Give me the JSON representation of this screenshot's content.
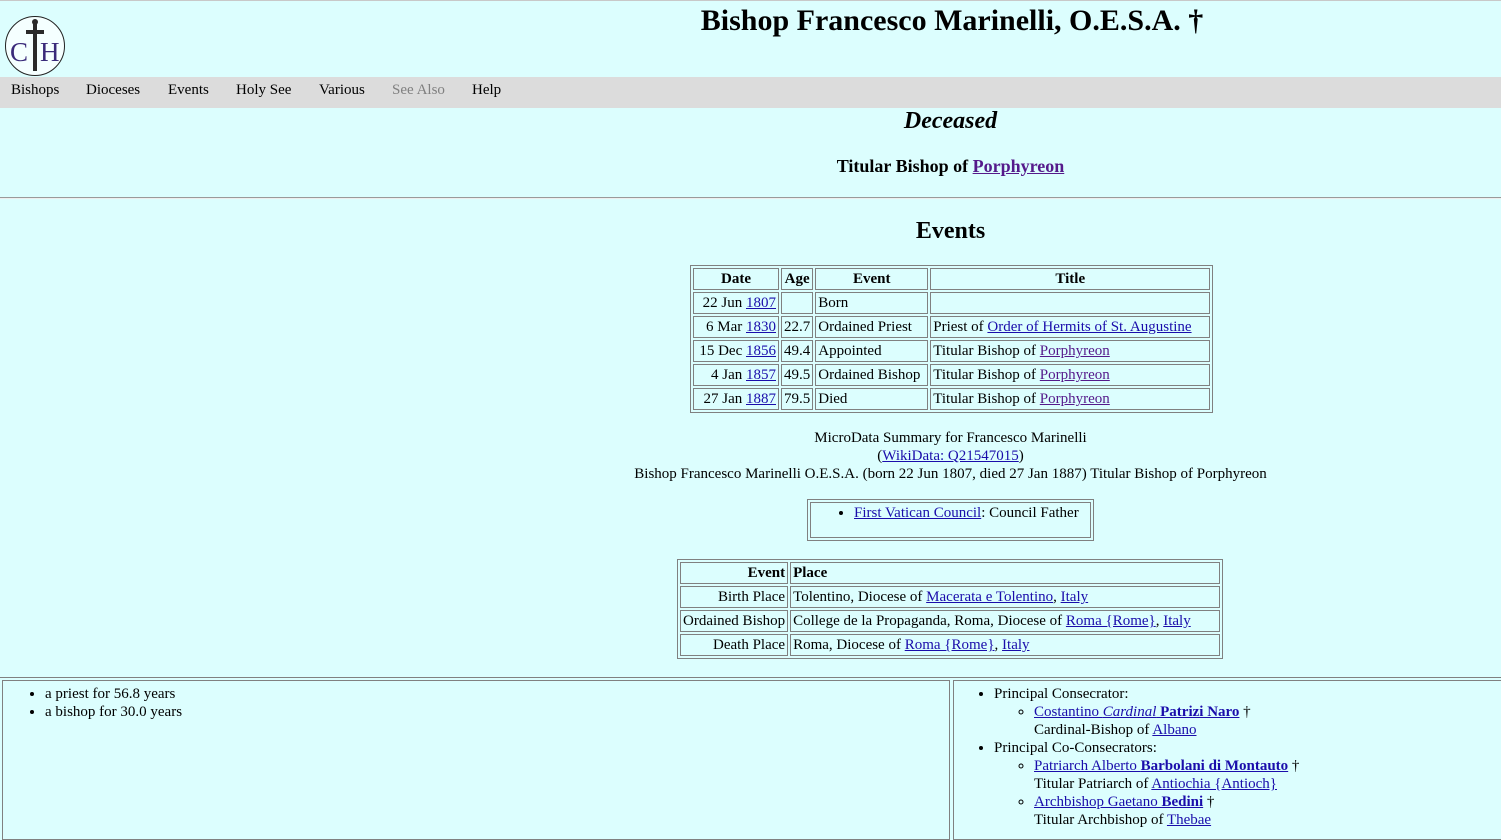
{
  "header": {
    "title": "Bishop Francesco Marinelli, O.E.S.A. †",
    "logo_icon": "catholic-hierarchy-cross-logo",
    "logo_letters": "CH"
  },
  "menu": [
    "Bishops",
    "Dioceses",
    "Events",
    "Holy See",
    "Various",
    "See Also",
    "Help"
  ],
  "status": "Deceased",
  "titular": {
    "prefix": "Titular Bishop of ",
    "link": "Porphyreon"
  },
  "events_heading": "Events",
  "events_table": {
    "headers": [
      "Date",
      "Age",
      "Event",
      "Title"
    ],
    "rows": [
      {
        "date": "22 Jun ",
        "year": "1807",
        "age": "",
        "event": "Born",
        "title_prefix": "",
        "title_link": ""
      },
      {
        "date": "6 Mar ",
        "year": "1830",
        "age": "22.7",
        "event": "Ordained Priest",
        "title_prefix": "Priest of ",
        "title_link": "Order of Hermits of St. Augustine"
      },
      {
        "date": "15 Dec ",
        "year": "1856",
        "age": "49.4",
        "event": "Appointed",
        "title_prefix": "Titular Bishop of ",
        "title_link": "Porphyreon"
      },
      {
        "date": "4 Jan ",
        "year": "1857",
        "age": "49.5",
        "event": "Ordained Bishop",
        "title_prefix": "Titular Bishop of ",
        "title_link": "Porphyreon"
      },
      {
        "date": "27 Jan ",
        "year": "1887",
        "age": "79.5",
        "event": "Died",
        "title_prefix": "Titular Bishop of ",
        "title_link": "Porphyreon"
      }
    ]
  },
  "microdata": {
    "line1": "MicroData Summary for Francesco Marinelli",
    "wikidata_open": "(",
    "wikidata_link": "WikiData: Q21547015",
    "wikidata_close": ")",
    "line3": "Bishop Francesco Marinelli O.E.S.A. (born 22 Jun 1807, died 27 Jan 1887) Titular Bishop of Porphyreon"
  },
  "council": {
    "link": "First Vatican Council",
    "role": ": Council Father"
  },
  "places_table": {
    "headers": [
      "Event",
      "Place"
    ],
    "rows": [
      {
        "label": "Birth Place",
        "prefix": "Tolentino, Diocese of ",
        "link1": "Macerata e Tolentino",
        "sep": ", ",
        "link2": "Italy"
      },
      {
        "label": "Ordained Bishop",
        "prefix": "College de la Propaganda, Roma, Diocese of ",
        "link1": "Roma {Rome}",
        "sep": ", ",
        "link2": "Italy"
      },
      {
        "label": "Death Place",
        "prefix": "Roma, Diocese of ",
        "link1": "Roma {Rome}",
        "sep": ", ",
        "link2": "Italy"
      }
    ]
  },
  "summary": [
    "a priest for 56.8 years",
    "a bishop for 30.0 years"
  ],
  "consecrators": {
    "principal_label": "Principal Consecrator:",
    "principal": {
      "first": "Costantino ",
      "cardinal": "Cardinal",
      "surname": " Patrizi Naro",
      "dagger": " †",
      "title_prefix": "Cardinal-Bishop of ",
      "title_link": "Albano"
    },
    "co_label": "Principal Co-Consecrators:",
    "co": [
      {
        "first": "Patriarch Alberto ",
        "surname": "Barbolani di Montauto",
        "dagger": " †",
        "title_prefix": "Titular Patriarch of ",
        "title_link": "Antiochia {Antioch}"
      },
      {
        "first": "Archbishop Gaetano ",
        "surname": "Bedini",
        "dagger": " †",
        "title_prefix": "Titular Archbishop of ",
        "title_link": "Thebae"
      }
    ]
  }
}
